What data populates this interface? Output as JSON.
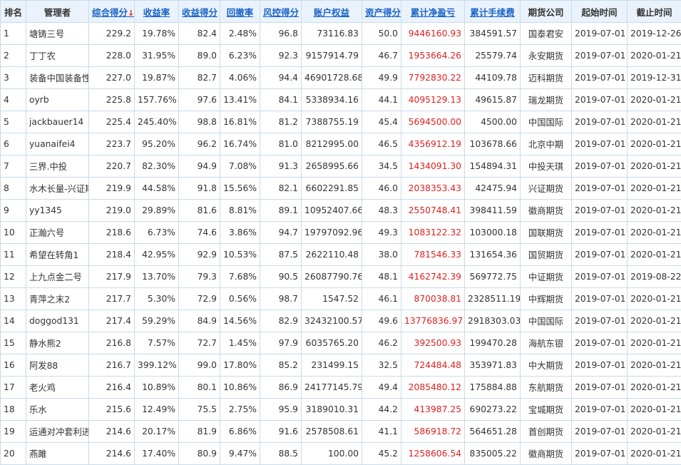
{
  "colors": {
    "header_bg": "#eaf3fb",
    "border": "#c9dbea",
    "link": "#1a64c8",
    "negative_red": "#e02020"
  },
  "headers": {
    "rank": "排名",
    "manager": "管理者",
    "composite": "综合得分",
    "sort_marker": "↓",
    "return_rate": "收益率",
    "return_score": "收益得分",
    "drawdown": "回撤率",
    "risk_score": "风控得分",
    "equity": "账户权益",
    "asset_score": "资产得分",
    "cum_pnl": "累计净盈亏",
    "cum_fee": "累计手续费",
    "broker": "期货公司",
    "start": "起始时间",
    "end": "截止时间"
  },
  "rows": [
    {
      "rank": "1",
      "manager": "塘铸三号",
      "composite": "229.2",
      "return_rate": "19.78%",
      "return_score": "82.4",
      "drawdown": "2.48%",
      "risk_score": "96.8",
      "equity": "73116.83",
      "asset_score": "50.0",
      "cum_pnl": "9446160.93",
      "cum_fee": "384591.57",
      "broker": "国泰君安",
      "start": "2019-07-01",
      "end": "2019-12-26"
    },
    {
      "rank": "2",
      "manager": "丁丁农",
      "composite": "228.0",
      "return_rate": "31.95%",
      "return_score": "89.0",
      "drawdown": "6.23%",
      "risk_score": "92.3",
      "equity": "9157914.79",
      "asset_score": "46.7",
      "cum_pnl": "1953664.26",
      "cum_fee": "25579.74",
      "broker": "永安期货",
      "start": "2019-07-01",
      "end": "2020-01-21"
    },
    {
      "rank": "3",
      "manager": "装备中国装备性",
      "composite": "227.0",
      "return_rate": "19.87%",
      "return_score": "82.7",
      "drawdown": "4.06%",
      "risk_score": "94.4",
      "equity": "46901728.68",
      "asset_score": "49.9",
      "cum_pnl": "7792830.22",
      "cum_fee": "44109.78",
      "broker": "迈科期货",
      "start": "2019-07-01",
      "end": "2019-12-31"
    },
    {
      "rank": "4",
      "manager": "oyrb",
      "composite": "225.8",
      "return_rate": "157.76%",
      "return_score": "97.6",
      "drawdown": "13.41%",
      "risk_score": "84.1",
      "equity": "5338934.16",
      "asset_score": "44.1",
      "cum_pnl": "4095129.13",
      "cum_fee": "49615.87",
      "broker": "瑞龙期货",
      "start": "2019-07-01",
      "end": "2020-01-21"
    },
    {
      "rank": "5",
      "manager": "jackbauer14",
      "composite": "225.4",
      "return_rate": "245.40%",
      "return_score": "98.8",
      "drawdown": "16.81%",
      "risk_score": "81.2",
      "equity": "7388755.19",
      "asset_score": "45.4",
      "cum_pnl": "5694500.00",
      "cum_fee": "4500.00",
      "broker": "中国国际",
      "start": "2019-07-01",
      "end": "2020-01-21"
    },
    {
      "rank": "6",
      "manager": "yuanaifei4",
      "composite": "223.7",
      "return_rate": "95.20%",
      "return_score": "96.2",
      "drawdown": "16.74%",
      "risk_score": "81.0",
      "equity": "8212995.00",
      "asset_score": "46.5",
      "cum_pnl": "4356912.19",
      "cum_fee": "103678.66",
      "broker": "北京中期",
      "start": "2019-07-01",
      "end": "2020-01-21"
    },
    {
      "rank": "7",
      "manager": "三界.中投",
      "composite": "220.7",
      "return_rate": "82.30%",
      "return_score": "94.9",
      "drawdown": "7.08%",
      "risk_score": "91.3",
      "equity": "2658995.66",
      "asset_score": "34.5",
      "cum_pnl": "1434091.30",
      "cum_fee": "154894.31",
      "broker": "中投天琪",
      "start": "2019-07-01",
      "end": "2020-01-21"
    },
    {
      "rank": "8",
      "manager": "水木长量-兴证期",
      "composite": "219.9",
      "return_rate": "44.58%",
      "return_score": "91.8",
      "drawdown": "15.56%",
      "risk_score": "82.1",
      "equity": "6602291.85",
      "asset_score": "46.0",
      "cum_pnl": "2038353.43",
      "cum_fee": "42475.94",
      "broker": "兴证期货",
      "start": "2019-07-01",
      "end": "2020-01-21"
    },
    {
      "rank": "9",
      "manager": "yy1345",
      "composite": "219.0",
      "return_rate": "29.89%",
      "return_score": "81.6",
      "drawdown": "8.81%",
      "risk_score": "89.1",
      "equity": "10952407.66",
      "asset_score": "48.3",
      "cum_pnl": "2550748.41",
      "cum_fee": "398411.59",
      "broker": "徽商期货",
      "start": "2019-07-01",
      "end": "2020-01-21"
    },
    {
      "rank": "10",
      "manager": "正瀚六号",
      "composite": "218.6",
      "return_rate": "6.73%",
      "return_score": "74.6",
      "drawdown": "3.86%",
      "risk_score": "94.7",
      "equity": "19797092.96",
      "asset_score": "49.3",
      "cum_pnl": "1083122.32",
      "cum_fee": "103000.18",
      "broker": "国联期货",
      "start": "2019-07-01",
      "end": "2020-01-21"
    },
    {
      "rank": "11",
      "manager": "希望在转角1",
      "composite": "218.4",
      "return_rate": "42.95%",
      "return_score": "92.9",
      "drawdown": "10.53%",
      "risk_score": "87.5",
      "equity": "2622110.48",
      "asset_score": "38.0",
      "cum_pnl": "781546.33",
      "cum_fee": "131654.36",
      "broker": "国贸期货",
      "start": "2019-07-01",
      "end": "2020-01-21"
    },
    {
      "rank": "12",
      "manager": "上九点金二号",
      "composite": "217.9",
      "return_rate": "13.70%",
      "return_score": "79.3",
      "drawdown": "7.68%",
      "risk_score": "90.5",
      "equity": "26087790.76",
      "asset_score": "48.1",
      "cum_pnl": "4162742.39",
      "cum_fee": "569772.75",
      "broker": "中证期货",
      "start": "2019-07-01",
      "end": "2019-08-22"
    },
    {
      "rank": "13",
      "manager": "青萍之末2",
      "composite": "217.7",
      "return_rate": "5.30%",
      "return_score": "72.9",
      "drawdown": "0.56%",
      "risk_score": "98.7",
      "equity": "1547.52",
      "asset_score": "46.1",
      "cum_pnl": "870038.81",
      "cum_fee": "2328511.19",
      "broker": "中辉期货",
      "start": "2019-07-01",
      "end": "2020-01-21"
    },
    {
      "rank": "14",
      "manager": "doggod131",
      "composite": "217.4",
      "return_rate": "59.29%",
      "return_score": "84.9",
      "drawdown": "14.56%",
      "risk_score": "82.9",
      "equity": "32432100.57",
      "asset_score": "49.6",
      "cum_pnl": "13776836.97",
      "cum_fee": "2918303.03",
      "broker": "中国国际",
      "start": "2019-07-01",
      "end": "2020-01-21"
    },
    {
      "rank": "15",
      "manager": "静水熊2",
      "composite": "216.8",
      "return_rate": "7.57%",
      "return_score": "72.7",
      "drawdown": "1.45%",
      "risk_score": "97.9",
      "equity": "6035765.20",
      "asset_score": "46.2",
      "cum_pnl": "392500.93",
      "cum_fee": "199470.28",
      "broker": "海航东银",
      "start": "2019-07-01",
      "end": "2020-01-21"
    },
    {
      "rank": "16",
      "manager": "阿发88",
      "composite": "216.7",
      "return_rate": "399.12%",
      "return_score": "99.0",
      "drawdown": "17.80%",
      "risk_score": "85.2",
      "equity": "231499.15",
      "asset_score": "32.5",
      "cum_pnl": "724484.48",
      "cum_fee": "353971.83",
      "broker": "中大期货",
      "start": "2019-07-01",
      "end": "2020-01-21"
    },
    {
      "rank": "17",
      "manager": "老火鸡",
      "composite": "216.4",
      "return_rate": "10.89%",
      "return_score": "80.1",
      "drawdown": "10.86%",
      "risk_score": "86.9",
      "equity": "24177145.79",
      "asset_score": "49.4",
      "cum_pnl": "2085480.12",
      "cum_fee": "175884.88",
      "broker": "东航期货",
      "start": "2019-07-01",
      "end": "2020-01-21"
    },
    {
      "rank": "18",
      "manager": "乐水",
      "composite": "215.6",
      "return_rate": "12.49%",
      "return_score": "75.5",
      "drawdown": "2.75%",
      "risk_score": "95.9",
      "equity": "3189010.31",
      "asset_score": "44.2",
      "cum_pnl": "413987.25",
      "cum_fee": "690273.22",
      "broker": "宝城期货",
      "start": "2019-07-01",
      "end": "2020-01-21"
    },
    {
      "rank": "19",
      "manager": "运通对冲套利进",
      "composite": "214.6",
      "return_rate": "20.17%",
      "return_score": "81.9",
      "drawdown": "6.86%",
      "risk_score": "91.6",
      "equity": "2578508.61",
      "asset_score": "41.1",
      "cum_pnl": "586918.72",
      "cum_fee": "564651.28",
      "broker": "首创期货",
      "start": "2019-07-01",
      "end": "2020-01-21"
    },
    {
      "rank": "20",
      "manager": "燕雎",
      "composite": "214.6",
      "return_rate": "17.40%",
      "return_score": "80.9",
      "drawdown": "9.47%",
      "risk_score": "88.5",
      "equity": "100.00",
      "asset_score": "45.2",
      "cum_pnl": "1258606.54",
      "cum_fee": "835005.22",
      "broker": "徽商期货",
      "start": "2019-07-01",
      "end": "2020-01-21"
    }
  ]
}
